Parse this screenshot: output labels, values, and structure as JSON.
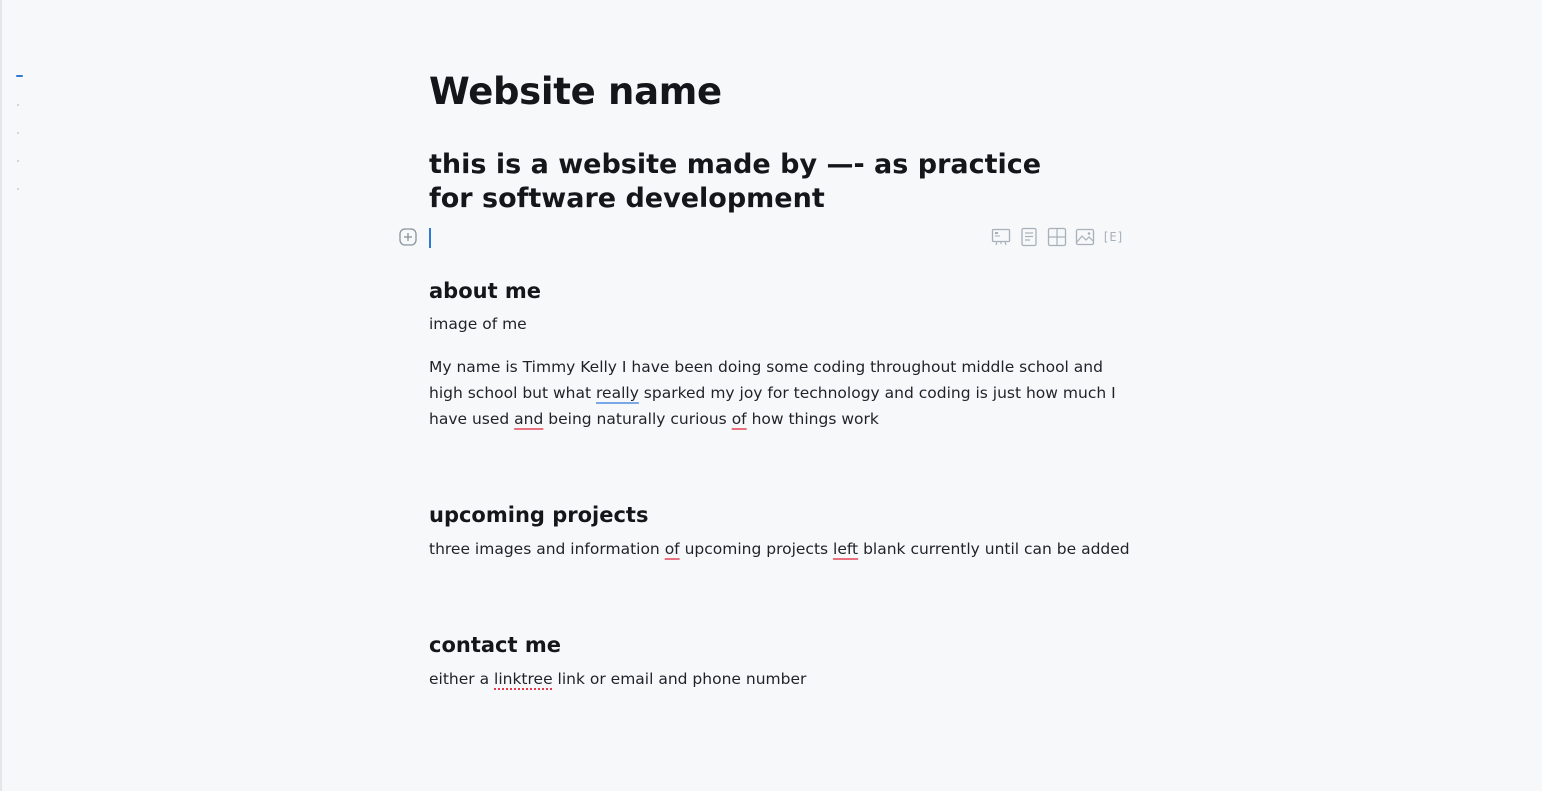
{
  "document": {
    "title": "Website name",
    "subtitle": "this is a website made by —- as practice for software development"
  },
  "toolbar": {
    "add_icon": "plus-circle-icon",
    "buttons": [
      {
        "icon": "presentation-icon"
      },
      {
        "icon": "document-icon"
      },
      {
        "icon": "table-grid-icon"
      },
      {
        "icon": "image-icon"
      },
      {
        "icon": "embed-icon",
        "label": "[E]"
      }
    ]
  },
  "sections": {
    "about": {
      "heading": "about me",
      "image_note": "image of me",
      "body_1": "My name is Timmy Kelly I have been doing some coding throughout middle school and",
      "body_2a": "high school but what ",
      "body_2b": "really",
      "body_2c": " sparked my joy for technology and coding is just how much I",
      "body_3a": "have used ",
      "body_3b": "and",
      "body_3c": " being naturally curious ",
      "body_3d": "of",
      "body_3e": " how things work"
    },
    "projects": {
      "heading": "upcoming projects",
      "body_a": "three images and information ",
      "body_b": "of",
      "body_c": " upcoming projects ",
      "body_d": "left",
      "body_e": " blank currently until can be added"
    },
    "contact": {
      "heading": "contact me",
      "body_a": "either a ",
      "body_b": "linktree",
      "body_c": " link or email and phone number"
    }
  },
  "colors": {
    "background": "#f6f8fa",
    "accent": "#2f7ad5",
    "spelling": "#e8717f",
    "grammar": "#7aa7e6"
  }
}
